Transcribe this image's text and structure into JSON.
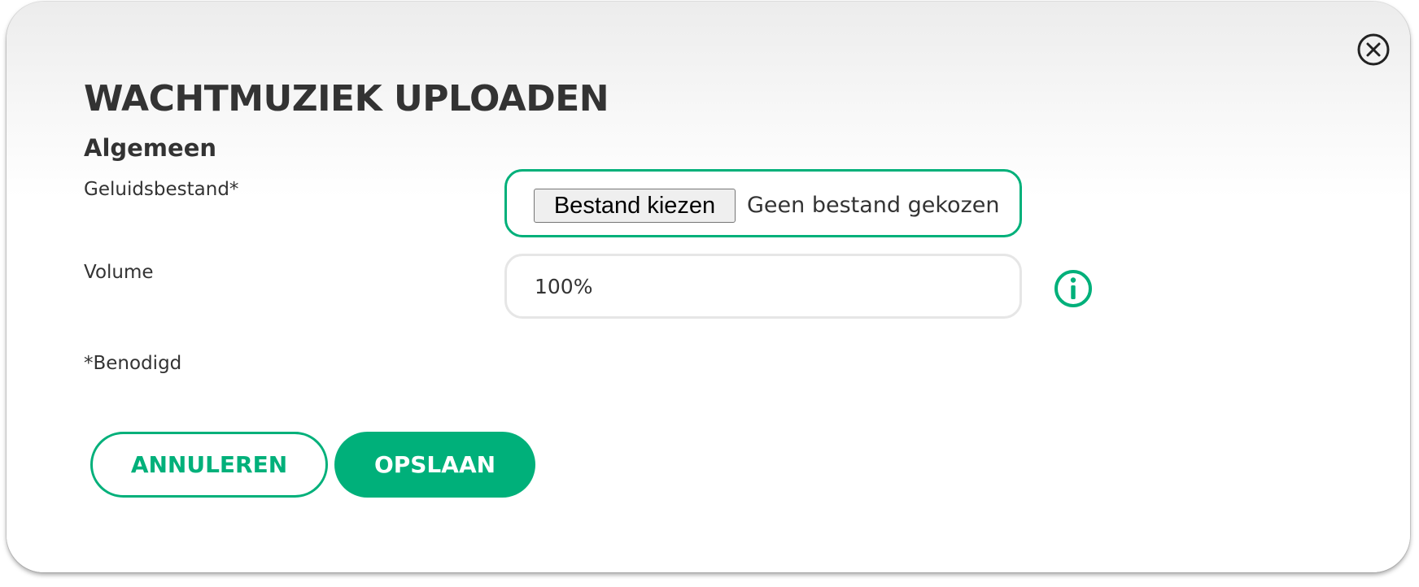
{
  "dialog": {
    "title": "WACHTMUZIEK UPLOADEN",
    "section_title": "Algemeen",
    "close_icon": "close-circle-icon"
  },
  "form": {
    "sound_file": {
      "label": "Geluidsbestand*",
      "button_label": "Bestand kiezen",
      "status_text": "Geen bestand gekozen"
    },
    "volume": {
      "label": "Volume",
      "value": "100%",
      "info_icon": "info-circle-icon"
    },
    "required_note": "*Benodigd"
  },
  "actions": {
    "cancel_label": "ANNULEREN",
    "save_label": "OPSLAAN"
  },
  "colors": {
    "accent": "#00b07a",
    "text": "#333333",
    "field_border": "#e6e6e6"
  }
}
